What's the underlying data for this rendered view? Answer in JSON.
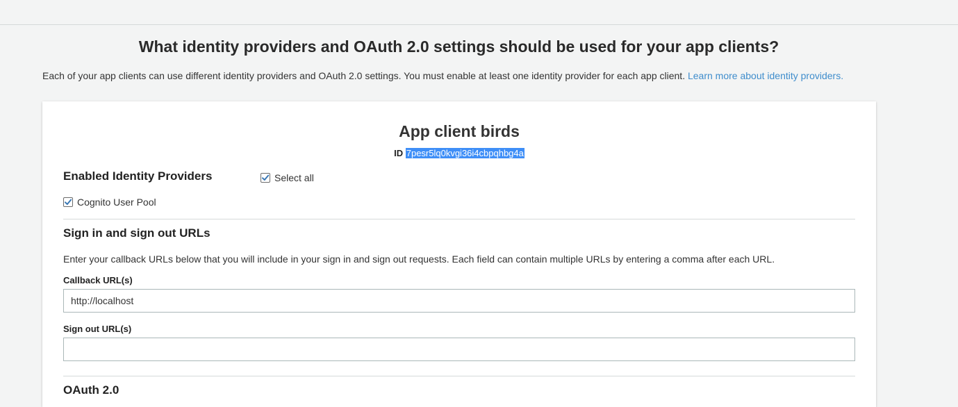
{
  "header": {
    "title": "What identity providers and OAuth 2.0 settings should be used for your app clients?",
    "description": "Each of your app clients can use different identity providers and OAuth 2.0 settings. You must enable at least one identity provider for each app client.",
    "learn_more_link": "Learn more about identity providers."
  },
  "app_client": {
    "name": "App client birds",
    "id_label": "ID",
    "id_value": "7pesr5lq0kvgi36i4cbpqhbg4a"
  },
  "identity_providers": {
    "title": "Enabled Identity Providers",
    "select_all_label": "Select all",
    "select_all_checked": true,
    "providers": [
      {
        "label": "Cognito User Pool",
        "checked": true
      }
    ]
  },
  "urls": {
    "title": "Sign in and sign out URLs",
    "help_text": "Enter your callback URLs below that you will include in your sign in and sign out requests. Each field can contain multiple URLs by entering a comma after each URL.",
    "callback_label": "Callback URL(s)",
    "callback_value": "http://localhost",
    "signout_label": "Sign out URL(s)",
    "signout_value": ""
  },
  "oauth": {
    "title": "OAuth 2.0"
  },
  "colors": {
    "link": "#3f8dcc",
    "checkbox_check": "#3a78b5",
    "selection": "#3e8ef7"
  }
}
